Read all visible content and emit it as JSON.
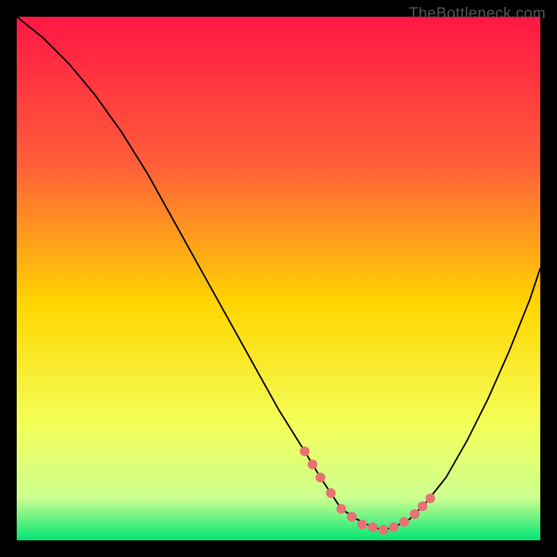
{
  "watermark": "TheBottleneck.com",
  "colors": {
    "background": "#000000",
    "gradient_top": "#ff1744",
    "gradient_mid_upper": "#ff5e3a",
    "gradient_mid": "#ffd600",
    "gradient_lower": "#f4ff5a",
    "gradient_bottom_band": "#ccff90",
    "gradient_bottom": "#00e676",
    "curve": "#000000",
    "marker": "#e57373"
  },
  "chart_data": {
    "type": "line",
    "title": "",
    "xlabel": "",
    "ylabel": "",
    "xlim": [
      0,
      100
    ],
    "ylim": [
      0,
      100
    ],
    "curve": {
      "name": "bottleneck-curve",
      "x": [
        0,
        5,
        10,
        15,
        20,
        25,
        30,
        35,
        40,
        45,
        50,
        55,
        58,
        60,
        62,
        65,
        68,
        70,
        72,
        75,
        78,
        82,
        86,
        90,
        94,
        98,
        100
      ],
      "y": [
        100,
        96,
        91,
        85,
        78,
        70,
        61,
        52,
        43,
        34,
        25,
        17,
        12,
        9,
        6,
        4,
        2.5,
        2,
        2.5,
        4,
        7,
        12,
        19,
        27,
        36,
        46,
        52
      ]
    },
    "markers": {
      "name": "highlight-points",
      "x": [
        55,
        56.5,
        58,
        60,
        62,
        64,
        66,
        68,
        70,
        72,
        74,
        76,
        77.5,
        79
      ],
      "y": [
        17,
        14.5,
        12,
        9,
        6,
        4.5,
        3,
        2.5,
        2,
        2.5,
        3.5,
        5,
        6.5,
        8
      ]
    }
  }
}
